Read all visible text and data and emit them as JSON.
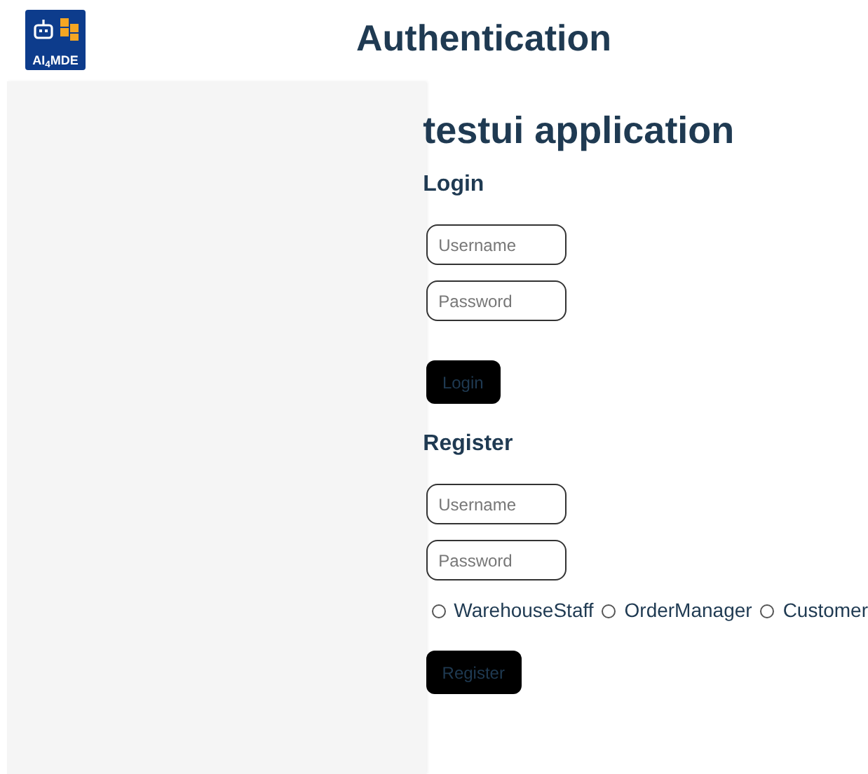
{
  "header": {
    "logo_text": "AI$_{4}$MDE",
    "title": "Authentication"
  },
  "app_title": "testui application",
  "login": {
    "heading": "Login",
    "fields": [
      {
        "placeholder": "Username"
      },
      {
        "placeholder": "Password"
      }
    ],
    "button": "Login"
  },
  "register": {
    "heading": "Register",
    "fields": [
      {
        "placeholder": "Username"
      },
      {
        "placeholder": "Password"
      }
    ],
    "roles": [
      {
        "label": "WarehouseStaff",
        "selected": false
      },
      {
        "label": "OrderManager",
        "selected": false
      },
      {
        "label": "Customer",
        "selected": false
      }
    ],
    "button": "Register"
  }
}
